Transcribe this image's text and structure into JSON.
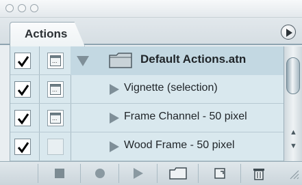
{
  "window": {
    "title": ""
  },
  "panel": {
    "tab_label": "Actions",
    "menu_button": "panel-menu"
  },
  "actions": [
    {
      "label": "Default Actions.atn",
      "type": "set",
      "checked": true,
      "dialog": true,
      "expanded": true,
      "selected": true
    },
    {
      "label": "Vignette (selection)",
      "type": "action",
      "checked": true,
      "dialog": true,
      "expanded": false,
      "selected": false
    },
    {
      "label": "Frame Channel - 50 pixel",
      "type": "action",
      "checked": true,
      "dialog": true,
      "expanded": false,
      "selected": false
    },
    {
      "label": "Wood Frame - 50 pixel",
      "type": "action",
      "checked": true,
      "dialog": false,
      "expanded": false,
      "selected": false
    }
  ],
  "toolbar": {
    "buttons": [
      "stop-icon",
      "record-icon",
      "play-icon",
      "new-set-icon",
      "new-action-icon",
      "trash-icon"
    ]
  },
  "colors": {
    "list_bg": "#d9e8ee",
    "selected_bg": "#c3d8e2",
    "accent": "#8ea4b0"
  }
}
